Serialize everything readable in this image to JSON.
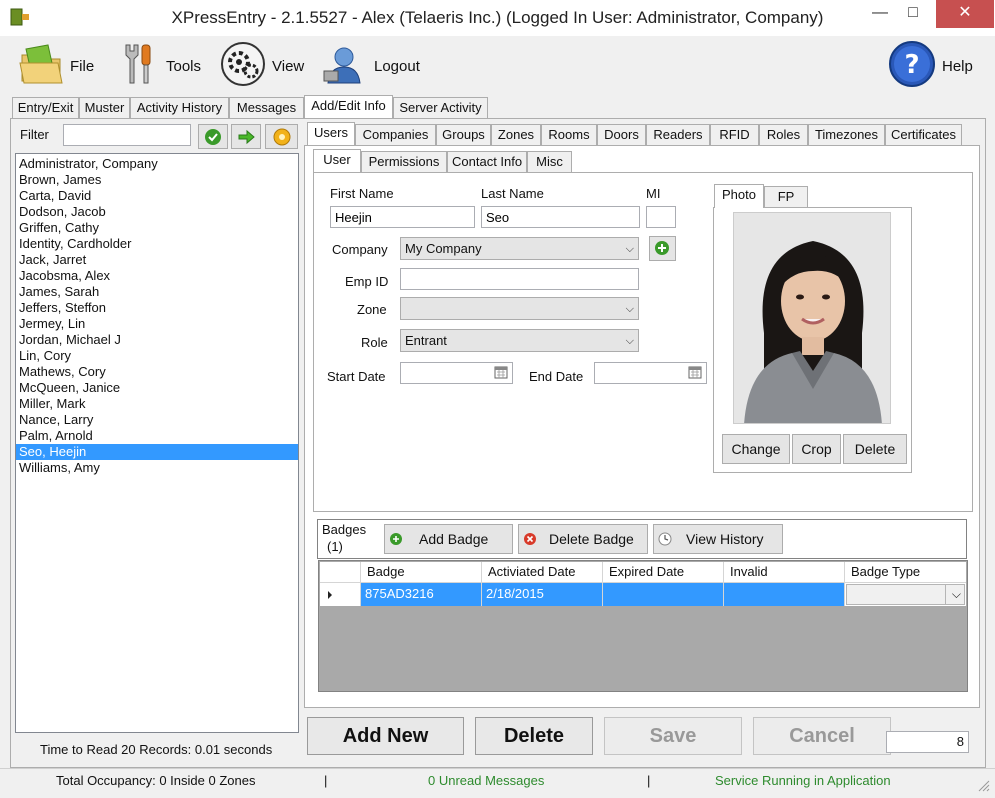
{
  "window": {
    "title": "XPressEntry - 2.1.5527 - Alex (Telaeris Inc.) (Logged In User: Administrator, Company)",
    "minimize": "—",
    "maximize": "□",
    "close": "✕"
  },
  "toolbar": {
    "file": "File",
    "tools": "Tools",
    "view": "View",
    "logout": "Logout",
    "help": "Help"
  },
  "main_tabs": [
    "Entry/Exit",
    "Muster",
    "Activity History",
    "Messages",
    "Add/Edit Info",
    "Server Activity"
  ],
  "filter": {
    "label": "Filter",
    "value": ""
  },
  "users": [
    "Administrator, Company",
    "Brown, James",
    "Carta, David",
    "Dodson, Jacob",
    "Griffen, Cathy",
    "Identity, Cardholder",
    "Jack, Jarret",
    "Jacobsma, Alex",
    "James, Sarah",
    "Jeffers, Steffon",
    "Jermey, Lin",
    "Jordan, Michael J",
    "Lin, Cory",
    "Mathews, Cory",
    "McQueen, Janice",
    "Miller, Mark",
    "Nance, Larry",
    "Palm, Arnold",
    "Seo, Heejin",
    "Williams, Amy"
  ],
  "selected_user": "Seo, Heejin",
  "read_time": "Time to Read 20 Records: 0.01 seconds",
  "entity_tabs": [
    "Users",
    "Companies",
    "Groups",
    "Zones",
    "Rooms",
    "Doors",
    "Readers",
    "RFID",
    "Roles",
    "Timezones",
    "Certificates"
  ],
  "user_tabs": [
    "User",
    "Permissions",
    "Contact Info",
    "Misc"
  ],
  "form": {
    "first_name_label": "First Name",
    "last_name_label": "Last Name",
    "mi_label": "MI",
    "first_name": "Heejin",
    "last_name": "Seo",
    "mi": "",
    "company_label": "Company",
    "company": "My Company",
    "emp_id_label": "Emp ID",
    "emp_id": "",
    "zone_label": "Zone",
    "zone": "",
    "role_label": "Role",
    "role": "Entrant",
    "start_date_label": "Start Date",
    "end_date_label": "End Date"
  },
  "photo": {
    "tabs": [
      "Photo",
      "FP"
    ],
    "change": "Change",
    "crop": "Crop",
    "delete": "Delete"
  },
  "badges": {
    "title": "Badges",
    "count": "(1)",
    "add": "Add Badge",
    "delete": "Delete Badge",
    "history": "View History",
    "columns": [
      "Badge",
      "Activiated Date",
      "Expired Date",
      "Invalid",
      "Badge Type"
    ],
    "rows": [
      {
        "badge": "875AD3216",
        "activated": "2/18/2015",
        "expired": "",
        "invalid": "",
        "type": ""
      }
    ]
  },
  "actions": {
    "add_new": "Add New",
    "delete": "Delete",
    "save": "Save",
    "cancel": "Cancel",
    "counter": "8"
  },
  "statusbar": {
    "occupancy": "Total Occupancy: 0 Inside 0 Zones",
    "sep1": "|",
    "messages": "0 Unread Messages",
    "sep2": "|",
    "service": "Service Running in Application"
  },
  "colors": {
    "selection": "#3399ff",
    "status_green": "#2e8b2e",
    "close_red": "#c75050"
  }
}
